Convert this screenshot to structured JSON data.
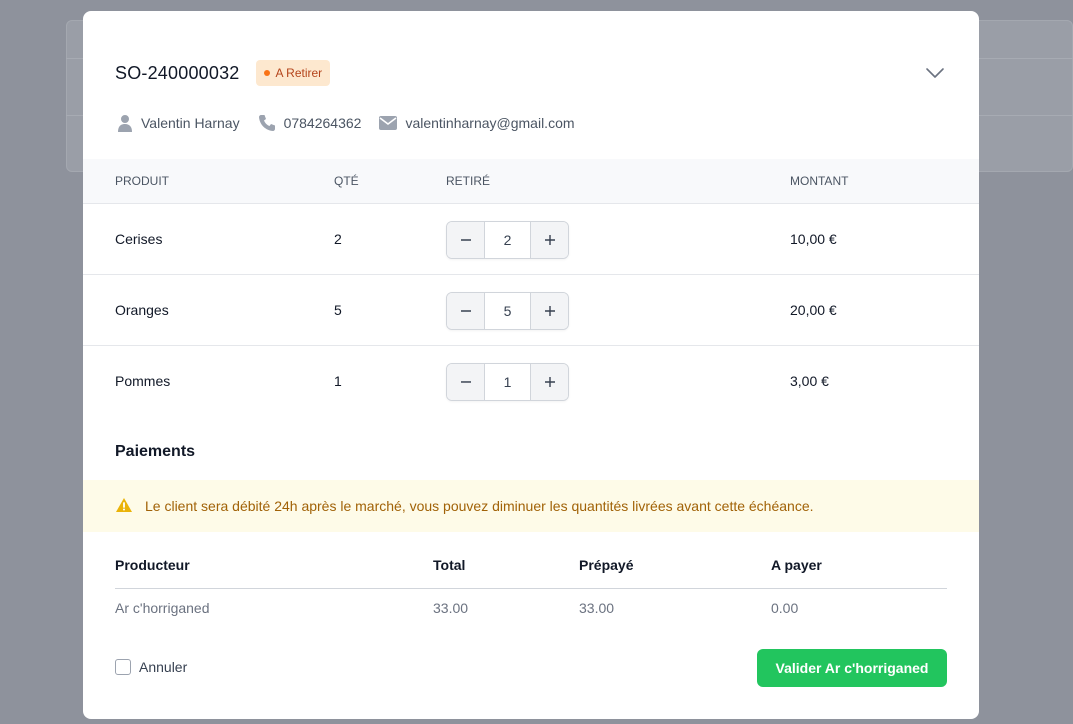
{
  "order": {
    "number": "SO-240000032",
    "status": "A Retirer",
    "status_color": "#f97316"
  },
  "customer": {
    "name": "Valentin Harnay",
    "phone": "0784264362",
    "email": "valentinharnay@gmail.com"
  },
  "items_table": {
    "headers": [
      "PRODUIT",
      "QTÉ",
      "RETIRÉ",
      "MONTANT"
    ],
    "rows": [
      {
        "product": "Cerises",
        "qty": "2",
        "withdrawn": "2",
        "amount": "10,00 €"
      },
      {
        "product": "Oranges",
        "qty": "5",
        "withdrawn": "5",
        "amount": "20,00 €"
      },
      {
        "product": "Pommes",
        "qty": "1",
        "withdrawn": "1",
        "amount": "3,00 €"
      }
    ]
  },
  "payments": {
    "title": "Paiements",
    "alert": "Le client sera débité 24h après le marché, vous pouvez diminuer les quantités livrées avant cette échéance.",
    "headers": [
      "Producteur",
      "Total",
      "Prépayé",
      "A payer"
    ],
    "rows": [
      {
        "producer": "Ar c'horriganed",
        "total": "33.00",
        "prepaid": "33.00",
        "to_pay": "0.00"
      }
    ]
  },
  "footer": {
    "cancel_label": "Annuler",
    "validate_label": "Valider Ar c'horriganed",
    "validate_color": "#22c55e"
  }
}
